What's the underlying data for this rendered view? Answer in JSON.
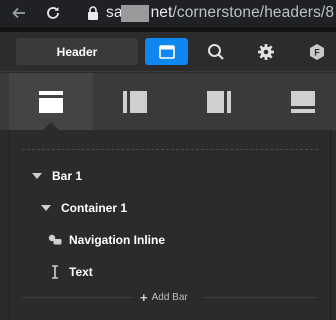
{
  "browser": {
    "url_prefix": "sa",
    "url_masked": "",
    "url_domain_rest": "net",
    "url_path": "/cornerstone/headers/8"
  },
  "toolbar": {
    "header_label": "Header"
  },
  "tree": {
    "bar_label": "Bar 1",
    "container_label": "Container 1",
    "nav_label": "Navigation Inline",
    "text_label": "Text"
  },
  "footer": {
    "add_bar_label": "Add Bar"
  },
  "colors": {
    "accent": "#0f87f0",
    "panel": "#2b2b2b",
    "tabs": "#3a3a3a"
  }
}
